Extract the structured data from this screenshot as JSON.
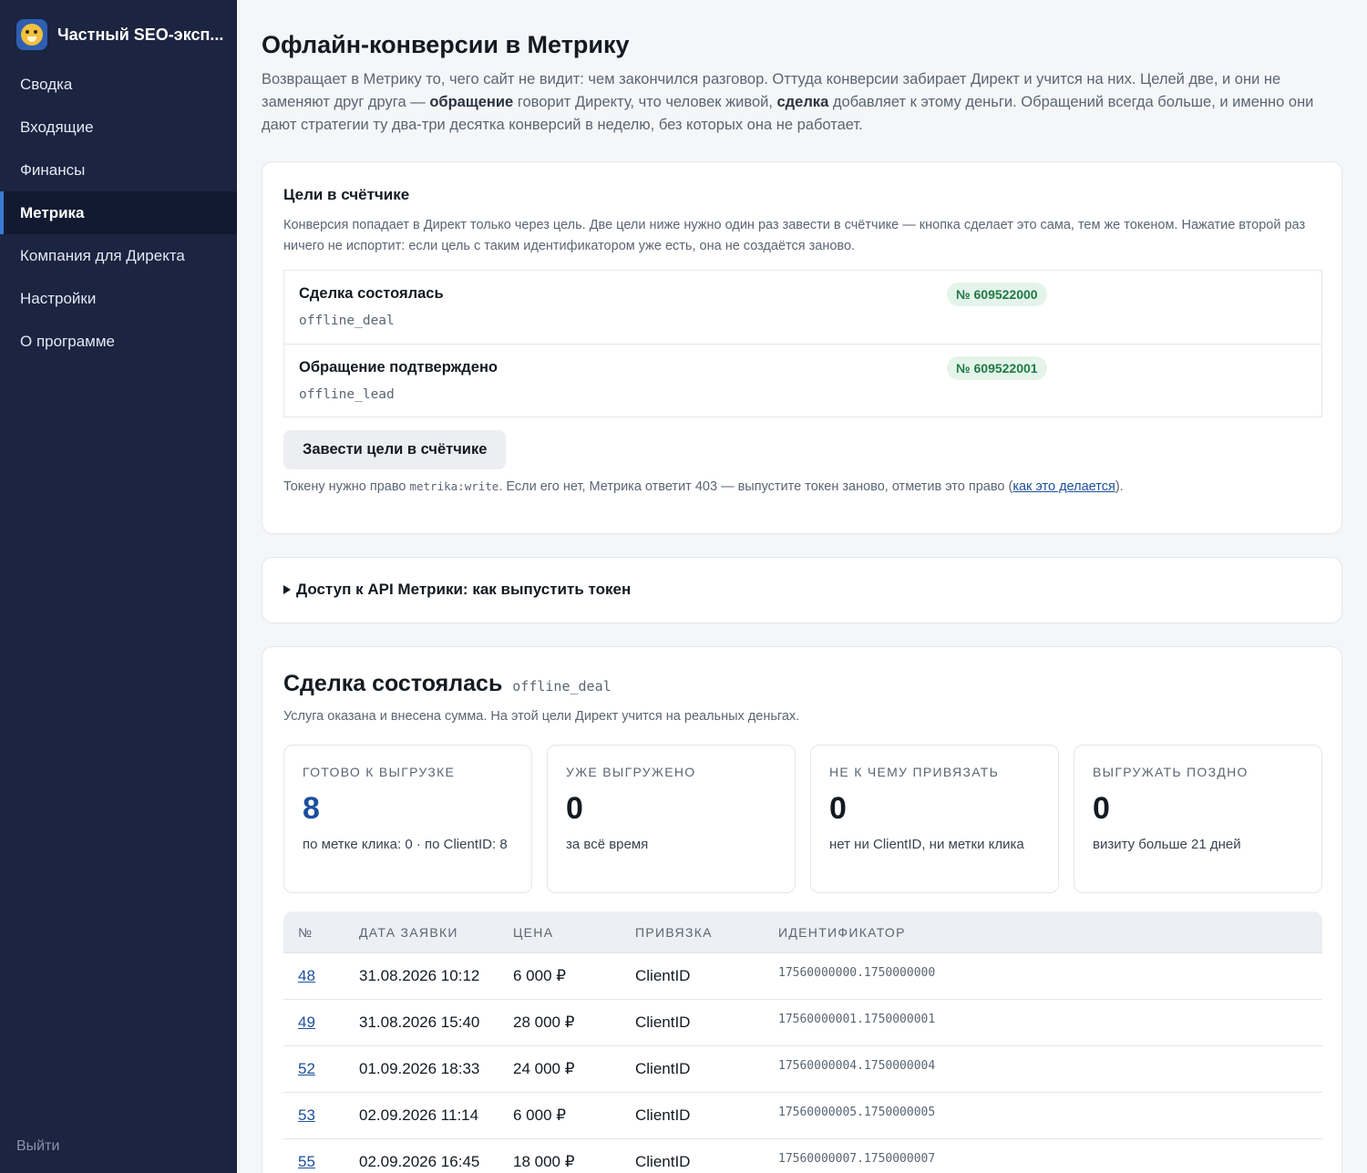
{
  "app": {
    "name": "Частный SEO-эксп...",
    "logout_label": "Выйти"
  },
  "sidebar": {
    "items": [
      {
        "label": "Сводка",
        "active": false
      },
      {
        "label": "Входящие",
        "active": false
      },
      {
        "label": "Финансы",
        "active": false
      },
      {
        "label": "Метрика",
        "active": true
      },
      {
        "label": "Компания для Директа",
        "active": false
      },
      {
        "label": "Настройки",
        "active": false
      },
      {
        "label": "О программе",
        "active": false
      }
    ]
  },
  "page": {
    "title": "Офлайн-конверсии в Метрику",
    "intro_1": "Возвращает в Метрику то, чего сайт не видит: чем закончился разговор. Оттуда конверсии забирает Директ и учится на них. Целей две, и они не заменяют друг друга — ",
    "intro_bold_1": "обращение",
    "intro_2": " говорит Директу, что человек живой, ",
    "intro_bold_2": "сделка",
    "intro_3": " добавляет к этому деньги. Обращений всегда больше, и именно они дают стратегии ту два-три десятка конверсий в неделю, без которых она не работает."
  },
  "goals": {
    "title": "Цели в счётчике",
    "description": "Конверсия попадает в Директ только через цель. Две цели ниже нужно один раз завести в счётчике — кнопка сделает это сама, тем же токеном. Нажатие второй раз ничего не испортит: если цель с таким идентификатором уже есть, она не создаётся заново.",
    "items": [
      {
        "name": "Сделка состоялась",
        "code": "offline_deal",
        "badge": "№ 609522000"
      },
      {
        "name": "Обращение подтверждено",
        "code": "offline_lead",
        "badge": "№ 609522001"
      }
    ],
    "button_label": "Завести цели в счётчике",
    "note_1": "Токену нужно право ",
    "note_code": "metrika:write",
    "note_2": ". Если его нет, Метрика ответит 403 — выпустите токен заново, отметив это право (",
    "note_link": "как это делается",
    "note_3": ")."
  },
  "api_access": {
    "summary": "Доступ к API Метрики: как выпустить токен"
  },
  "deal_section": {
    "title": "Сделка состоялась",
    "code": "offline_deal",
    "description": "Услуга оказана и внесена сумма. На этой цели Директ учится на реальных деньгах.",
    "stats": [
      {
        "label": "ГОТОВО К ВЫГРУЗКЕ",
        "value": "8",
        "sub": "по метке клика: 0 · по ClientID: 8",
        "accent": true
      },
      {
        "label": "УЖЕ ВЫГРУЖЕНО",
        "value": "0",
        "sub": "за всё время",
        "accent": false
      },
      {
        "label": "НЕ К ЧЕМУ ПРИВЯЗАТЬ",
        "value": "0",
        "sub": "нет ни ClientID, ни метки клика",
        "accent": false
      },
      {
        "label": "ВЫГРУЖАТЬ ПОЗДНО",
        "value": "0",
        "sub": "визиту больше 21 дней",
        "accent": false
      }
    ],
    "table": {
      "headers": [
        "№",
        "ДАТА ЗАЯВКИ",
        "ЦЕНА",
        "ПРИВЯЗКА",
        "ИДЕНТИФИКАТОР"
      ],
      "rows": [
        {
          "num": "48",
          "date": "31.08.2026 10:12",
          "price": "6 000 ₽",
          "binding": "ClientID",
          "id": "17560000000.1750000000"
        },
        {
          "num": "49",
          "date": "31.08.2026 15:40",
          "price": "28 000 ₽",
          "binding": "ClientID",
          "id": "17560000001.1750000001"
        },
        {
          "num": "52",
          "date": "01.09.2026 18:33",
          "price": "24 000 ₽",
          "binding": "ClientID",
          "id": "17560000004.1750000004"
        },
        {
          "num": "53",
          "date": "02.09.2026 11:14",
          "price": "6 000 ₽",
          "binding": "ClientID",
          "id": "17560000005.1750000005"
        },
        {
          "num": "55",
          "date": "02.09.2026 16:45",
          "price": "18 000 ₽",
          "binding": "ClientID",
          "id": "17560000007.1750000007"
        }
      ]
    }
  }
}
